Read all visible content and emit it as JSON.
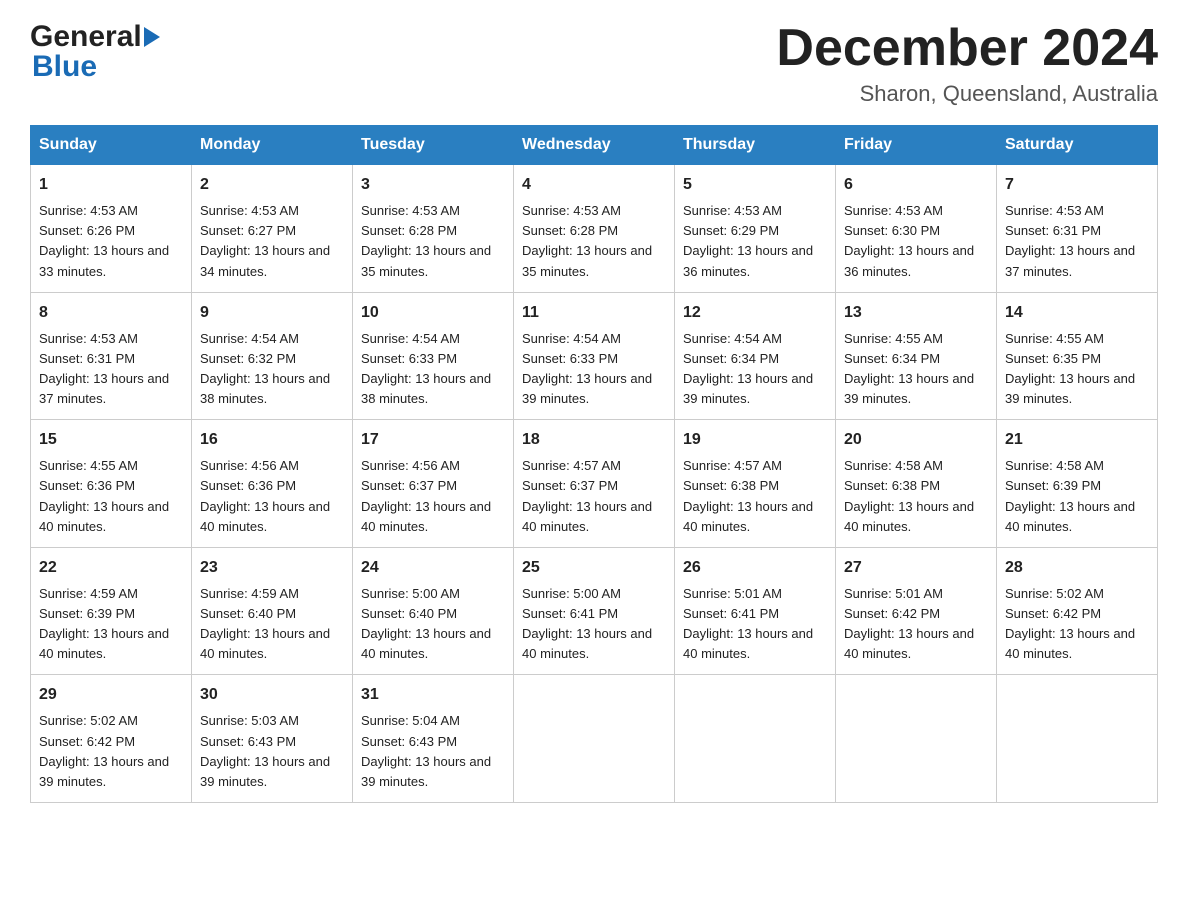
{
  "header": {
    "title": "December 2024",
    "subtitle": "Sharon, Queensland, Australia"
  },
  "logo": {
    "general": "General",
    "blue": "Blue"
  },
  "days_of_week": [
    "Sunday",
    "Monday",
    "Tuesday",
    "Wednesday",
    "Thursday",
    "Friday",
    "Saturday"
  ],
  "weeks": [
    [
      {
        "day": "1",
        "sunrise": "4:53 AM",
        "sunset": "6:26 PM",
        "daylight": "13 hours and 33 minutes."
      },
      {
        "day": "2",
        "sunrise": "4:53 AM",
        "sunset": "6:27 PM",
        "daylight": "13 hours and 34 minutes."
      },
      {
        "day": "3",
        "sunrise": "4:53 AM",
        "sunset": "6:28 PM",
        "daylight": "13 hours and 35 minutes."
      },
      {
        "day": "4",
        "sunrise": "4:53 AM",
        "sunset": "6:28 PM",
        "daylight": "13 hours and 35 minutes."
      },
      {
        "day": "5",
        "sunrise": "4:53 AM",
        "sunset": "6:29 PM",
        "daylight": "13 hours and 36 minutes."
      },
      {
        "day": "6",
        "sunrise": "4:53 AM",
        "sunset": "6:30 PM",
        "daylight": "13 hours and 36 minutes."
      },
      {
        "day": "7",
        "sunrise": "4:53 AM",
        "sunset": "6:31 PM",
        "daylight": "13 hours and 37 minutes."
      }
    ],
    [
      {
        "day": "8",
        "sunrise": "4:53 AM",
        "sunset": "6:31 PM",
        "daylight": "13 hours and 37 minutes."
      },
      {
        "day": "9",
        "sunrise": "4:54 AM",
        "sunset": "6:32 PM",
        "daylight": "13 hours and 38 minutes."
      },
      {
        "day": "10",
        "sunrise": "4:54 AM",
        "sunset": "6:33 PM",
        "daylight": "13 hours and 38 minutes."
      },
      {
        "day": "11",
        "sunrise": "4:54 AM",
        "sunset": "6:33 PM",
        "daylight": "13 hours and 39 minutes."
      },
      {
        "day": "12",
        "sunrise": "4:54 AM",
        "sunset": "6:34 PM",
        "daylight": "13 hours and 39 minutes."
      },
      {
        "day": "13",
        "sunrise": "4:55 AM",
        "sunset": "6:34 PM",
        "daylight": "13 hours and 39 minutes."
      },
      {
        "day": "14",
        "sunrise": "4:55 AM",
        "sunset": "6:35 PM",
        "daylight": "13 hours and 39 minutes."
      }
    ],
    [
      {
        "day": "15",
        "sunrise": "4:55 AM",
        "sunset": "6:36 PM",
        "daylight": "13 hours and 40 minutes."
      },
      {
        "day": "16",
        "sunrise": "4:56 AM",
        "sunset": "6:36 PM",
        "daylight": "13 hours and 40 minutes."
      },
      {
        "day": "17",
        "sunrise": "4:56 AM",
        "sunset": "6:37 PM",
        "daylight": "13 hours and 40 minutes."
      },
      {
        "day": "18",
        "sunrise": "4:57 AM",
        "sunset": "6:37 PM",
        "daylight": "13 hours and 40 minutes."
      },
      {
        "day": "19",
        "sunrise": "4:57 AM",
        "sunset": "6:38 PM",
        "daylight": "13 hours and 40 minutes."
      },
      {
        "day": "20",
        "sunrise": "4:58 AM",
        "sunset": "6:38 PM",
        "daylight": "13 hours and 40 minutes."
      },
      {
        "day": "21",
        "sunrise": "4:58 AM",
        "sunset": "6:39 PM",
        "daylight": "13 hours and 40 minutes."
      }
    ],
    [
      {
        "day": "22",
        "sunrise": "4:59 AM",
        "sunset": "6:39 PM",
        "daylight": "13 hours and 40 minutes."
      },
      {
        "day": "23",
        "sunrise": "4:59 AM",
        "sunset": "6:40 PM",
        "daylight": "13 hours and 40 minutes."
      },
      {
        "day": "24",
        "sunrise": "5:00 AM",
        "sunset": "6:40 PM",
        "daylight": "13 hours and 40 minutes."
      },
      {
        "day": "25",
        "sunrise": "5:00 AM",
        "sunset": "6:41 PM",
        "daylight": "13 hours and 40 minutes."
      },
      {
        "day": "26",
        "sunrise": "5:01 AM",
        "sunset": "6:41 PM",
        "daylight": "13 hours and 40 minutes."
      },
      {
        "day": "27",
        "sunrise": "5:01 AM",
        "sunset": "6:42 PM",
        "daylight": "13 hours and 40 minutes."
      },
      {
        "day": "28",
        "sunrise": "5:02 AM",
        "sunset": "6:42 PM",
        "daylight": "13 hours and 40 minutes."
      }
    ],
    [
      {
        "day": "29",
        "sunrise": "5:02 AM",
        "sunset": "6:42 PM",
        "daylight": "13 hours and 39 minutes."
      },
      {
        "day": "30",
        "sunrise": "5:03 AM",
        "sunset": "6:43 PM",
        "daylight": "13 hours and 39 minutes."
      },
      {
        "day": "31",
        "sunrise": "5:04 AM",
        "sunset": "6:43 PM",
        "daylight": "13 hours and 39 minutes."
      },
      null,
      null,
      null,
      null
    ]
  ]
}
